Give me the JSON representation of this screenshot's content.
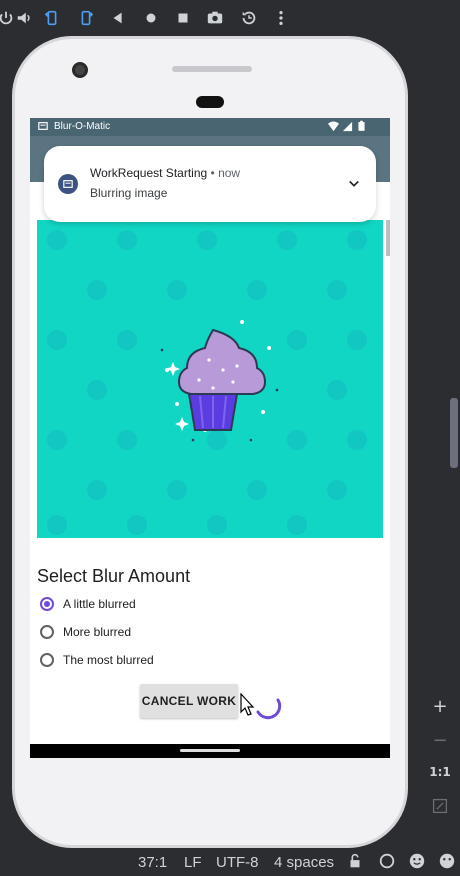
{
  "emulator_toolbar": {
    "icons": [
      "power-icon",
      "volume-up-icon",
      "volume-down-icon",
      "rotate-left-icon",
      "rotate-right-icon",
      "back-icon",
      "home-icon",
      "overview-icon",
      "screenshot-icon",
      "snapshot-icon",
      "more-icon"
    ]
  },
  "device": {
    "status_bar": {
      "app_name": "Blur-O-Matic"
    },
    "notification": {
      "title": "WorkRequest Starting",
      "time": "now",
      "text": "Blurring image"
    },
    "main": {
      "section_title": "Select Blur Amount",
      "options": [
        {
          "label": "A little blurred",
          "checked": true
        },
        {
          "label": "More blurred",
          "checked": false
        },
        {
          "label": "The most blurred",
          "checked": false
        }
      ],
      "cancel_button": "CANCEL WORK"
    }
  },
  "ide_side": {
    "zoom_ratio": "1:1"
  },
  "ide_status": {
    "position": "37:1",
    "line_separator": "LF",
    "encoding": "UTF-8",
    "indent": "4 spaces"
  },
  "colors": {
    "accent": "#6f4bd8",
    "image_bg": "#11d6c4",
    "appbar": "#5b7482"
  }
}
